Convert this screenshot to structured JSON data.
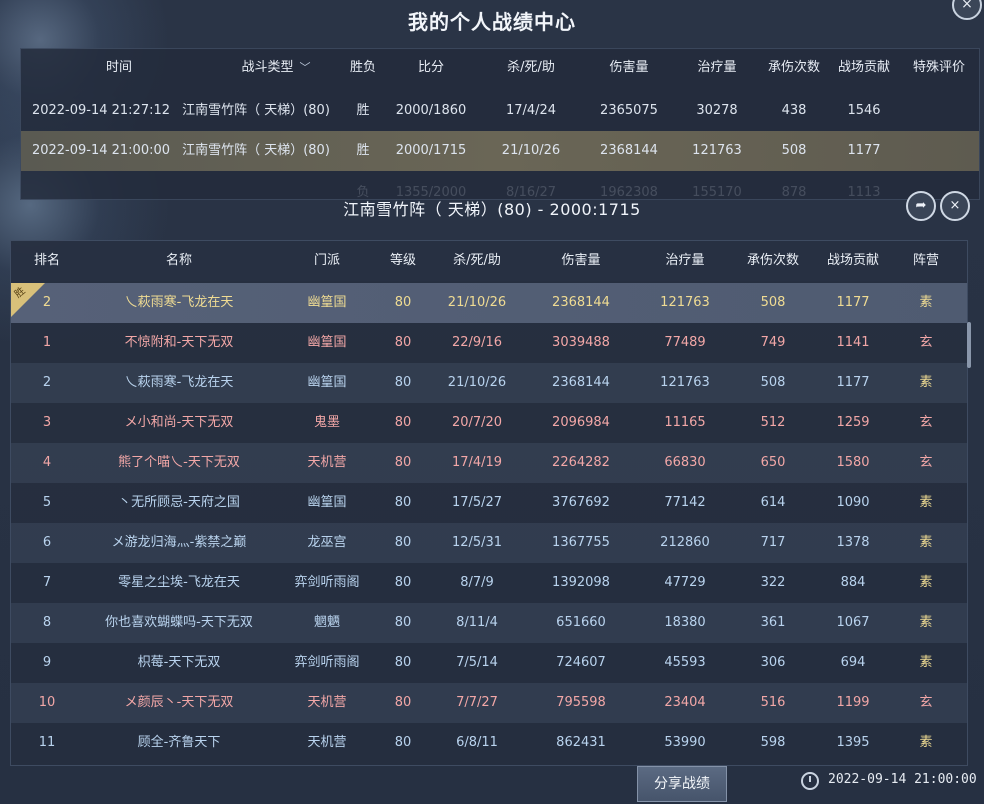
{
  "window": {
    "title": "我的个人战绩中心",
    "close_icon": "×"
  },
  "summary": {
    "headers": {
      "time": "时间",
      "type": "战斗类型",
      "result": "胜负",
      "score": "比分",
      "kda": "杀/死/助",
      "damage": "伤害量",
      "heal": "治疗量",
      "taken": "承伤次数",
      "contribution": "战场贡献",
      "special": "特殊评价"
    },
    "filter_icon": "chevron-down-icon",
    "rows": [
      {
        "time": "2022-09-14 21:27:12",
        "type": "江南雪竹阵（ 天梯）(80)",
        "result": "胜",
        "score": "2000/1860",
        "kda": "17/4/24",
        "damage": "2365075",
        "heal": "30278",
        "taken": "438",
        "contribution": "1546",
        "special": ""
      },
      {
        "time": "2022-09-14 21:00:00",
        "type": "江南雪竹阵（ 天梯）(80)",
        "result": "胜",
        "score": "2000/1715",
        "kda": "21/10/26",
        "damage": "2368144",
        "heal": "121763",
        "taken": "508",
        "contribution": "1177",
        "special": ""
      },
      {
        "time": "",
        "type": "",
        "result": "负",
        "score": "1355/2000",
        "kda": "8/16/27",
        "damage": "1962308",
        "heal": "155170",
        "taken": "878",
        "contribution": "1113",
        "special": ""
      }
    ]
  },
  "match": {
    "title": "江南雪竹阵（ 天梯）(80) - 2000:1715",
    "share_icon": "➦",
    "close_icon": "×"
  },
  "detail": {
    "headers": {
      "rank": "排名",
      "name": "名称",
      "school": "门派",
      "level": "等级",
      "kda": "杀/死/助",
      "damage": "伤害量",
      "heal": "治疗量",
      "taken": "承伤次数",
      "contribution": "战场贡献",
      "camp": "阵营"
    },
    "win_badge": "胜",
    "rows": [
      {
        "rank": "2",
        "name": "乀萩雨寒-飞龙在天",
        "school": "幽篁国",
        "level": "80",
        "kda": "21/10/26",
        "damage": "2368144",
        "heal": "121763",
        "taken": "508",
        "contribution": "1177",
        "camp": "素"
      },
      {
        "rank": "1",
        "name": "不惊附和-天下无双",
        "school": "幽篁国",
        "level": "80",
        "kda": "22/9/16",
        "damage": "3039488",
        "heal": "77489",
        "taken": "749",
        "contribution": "1141",
        "camp": "玄"
      },
      {
        "rank": "2",
        "name": "乀萩雨寒-飞龙在天",
        "school": "幽篁国",
        "level": "80",
        "kda": "21/10/26",
        "damage": "2368144",
        "heal": "121763",
        "taken": "508",
        "contribution": "1177",
        "camp": "素"
      },
      {
        "rank": "3",
        "name": "メ小和尚-天下无双",
        "school": "鬼墨",
        "level": "80",
        "kda": "20/7/20",
        "damage": "2096984",
        "heal": "11165",
        "taken": "512",
        "contribution": "1259",
        "camp": "玄"
      },
      {
        "rank": "4",
        "name": "熊了个喵乀-天下无双",
        "school": "天机营",
        "level": "80",
        "kda": "17/4/19",
        "damage": "2264282",
        "heal": "66830",
        "taken": "650",
        "contribution": "1580",
        "camp": "玄"
      },
      {
        "rank": "5",
        "name": "丶无所顾忌-天府之国",
        "school": "幽篁国",
        "level": "80",
        "kda": "17/5/27",
        "damage": "3767692",
        "heal": "77142",
        "taken": "614",
        "contribution": "1090",
        "camp": "素"
      },
      {
        "rank": "6",
        "name": "メ游龙归海灬-紫禁之巅",
        "school": "龙巫宫",
        "level": "80",
        "kda": "12/5/31",
        "damage": "1367755",
        "heal": "212860",
        "taken": "717",
        "contribution": "1378",
        "camp": "素"
      },
      {
        "rank": "7",
        "name": "零星之尘埃-飞龙在天",
        "school": "弈剑听雨阁",
        "level": "80",
        "kda": "8/7/9",
        "damage": "1392098",
        "heal": "47729",
        "taken": "322",
        "contribution": "884",
        "camp": "素"
      },
      {
        "rank": "8",
        "name": "你也喜欢蝴蝶吗-天下无双",
        "school": "魍魉",
        "level": "80",
        "kda": "8/11/4",
        "damage": "651660",
        "heal": "18380",
        "taken": "361",
        "contribution": "1067",
        "camp": "素"
      },
      {
        "rank": "9",
        "name": "枳莓-天下无双",
        "school": "弈剑听雨阁",
        "level": "80",
        "kda": "7/5/14",
        "damage": "724607",
        "heal": "45593",
        "taken": "306",
        "contribution": "694",
        "camp": "素"
      },
      {
        "rank": "10",
        "name": "メ颜辰丶-天下无双",
        "school": "天机营",
        "level": "80",
        "kda": "7/7/27",
        "damage": "795598",
        "heal": "23404",
        "taken": "516",
        "contribution": "1199",
        "camp": "玄"
      },
      {
        "rank": "11",
        "name": "顾全-齐鲁天下",
        "school": "天机营",
        "level": "80",
        "kda": "6/8/11",
        "damage": "862431",
        "heal": "53990",
        "taken": "598",
        "contribution": "1395",
        "camp": "素"
      }
    ]
  },
  "footer": {
    "share_button": "分享战绩",
    "clock_icon": "clock-icon",
    "time": "2022-09-14 21:00:00"
  },
  "colors": {
    "xuan": "#f2a7a7",
    "su": "#f0dc93",
    "self_row": "#566178",
    "selected_summary_row": "#6a6656"
  }
}
